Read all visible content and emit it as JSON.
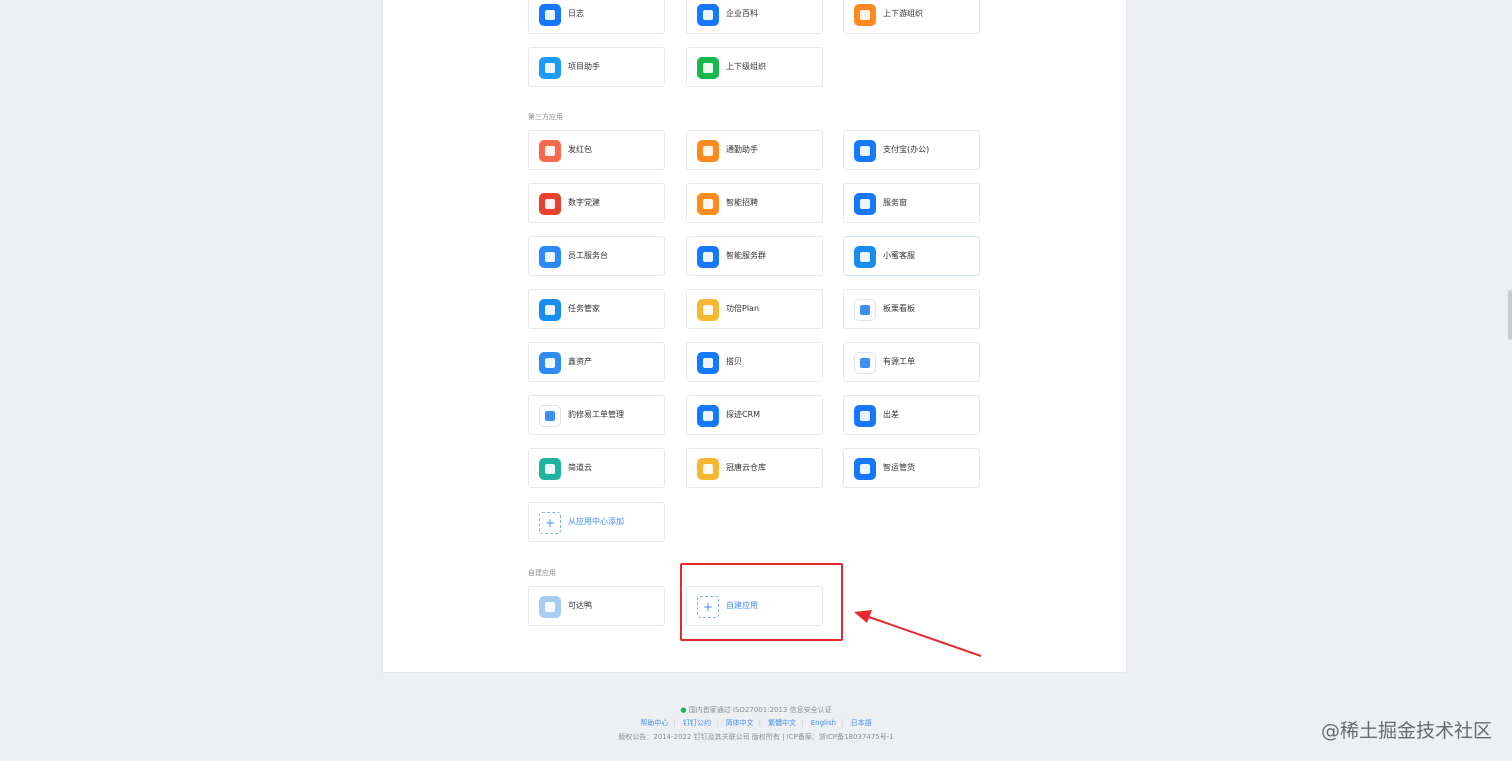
{
  "builtin_apps": [
    {
      "label": "日志",
      "icon": "log-icon",
      "color": "#1677ff"
    },
    {
      "label": "企业百科",
      "icon": "encyclopedia-icon",
      "color": "#1677ff"
    },
    {
      "label": "上下游组织",
      "icon": "supply-chain-org-icon",
      "color": "#ff8a1f"
    },
    {
      "label": "项目助手",
      "icon": "project-assistant-icon",
      "color": "#1a9dfa"
    },
    {
      "label": "上下级组织",
      "icon": "hierarchy-org-icon",
      "color": "#17b84a"
    }
  ],
  "third_party_title": "第三方应用",
  "third_party_apps": [
    {
      "label": "发红包",
      "icon": "red-packet-icon",
      "color": "#f56a4a"
    },
    {
      "label": "通勤助手",
      "icon": "commute-assistant-icon",
      "color": "#ff8a1f"
    },
    {
      "label": "支付宝(办公)",
      "icon": "alipay-icon",
      "color": "#1677ff"
    },
    {
      "label": "数字党建",
      "icon": "party-building-icon",
      "color": "#e8412f"
    },
    {
      "label": "智能招聘",
      "icon": "recruitment-icon",
      "color": "#ff8a1f"
    },
    {
      "label": "服务窗",
      "icon": "service-window-icon",
      "color": "#1677ff"
    },
    {
      "label": "员工服务台",
      "icon": "employee-service-icon",
      "color": "#2b8af7"
    },
    {
      "label": "智能服务群",
      "icon": "service-group-icon",
      "color": "#1677ff"
    },
    {
      "label": "小蜜客服",
      "icon": "customer-service-icon",
      "color": "#1a8cf0"
    },
    {
      "label": "任务管家",
      "icon": "task-manager-icon",
      "color": "#1a8cf0"
    },
    {
      "label": "功倍Plan",
      "icon": "plan-icon",
      "color": "#f7b731"
    },
    {
      "label": "板栗看板",
      "icon": "kanban-icon",
      "color": "#ffffff"
    },
    {
      "label": "鑫资产",
      "icon": "asset-icon",
      "color": "#2f8cf0"
    },
    {
      "label": "搭贝",
      "icon": "dabei-icon",
      "color": "#1677ff"
    },
    {
      "label": "有源工单",
      "icon": "work-order-icon",
      "color": "#ffffff"
    },
    {
      "label": "豹修易工单管理",
      "icon": "leopard-repair-icon",
      "color": "#ffffff"
    },
    {
      "label": "探迹CRM",
      "icon": "crm-icon",
      "color": "#1677ff"
    },
    {
      "label": "出差",
      "icon": "business-trip-icon",
      "color": "#1677ff"
    },
    {
      "label": "简道云",
      "icon": "cloud-icon",
      "color": "#1fb3a0"
    },
    {
      "label": "冠唐云仓库",
      "icon": "warehouse-icon",
      "color": "#f7b731"
    },
    {
      "label": "智运管货",
      "icon": "logistics-icon",
      "color": "#1677ff"
    }
  ],
  "add_from_center_label": "从应用中心添加",
  "custom_title": "自建应用",
  "custom_apps": [
    {
      "label": "可达鸭",
      "icon": "psyduck-icon",
      "color": "#a8cdf2"
    }
  ],
  "create_app_label": "自建应用",
  "footer": {
    "cert": "国内首家通过 ISO27001:2013 信息安全认证",
    "links": [
      "帮助中心",
      "钉钉公约",
      "简体中文",
      "繁體中文",
      "English",
      "日本語"
    ],
    "copyright": "版权公告：2014-2022 钉钉及其关联公司 版权所有 | ICP备案：浙ICP备18037475号-1"
  },
  "watermark": "@稀土掘金技术社区"
}
